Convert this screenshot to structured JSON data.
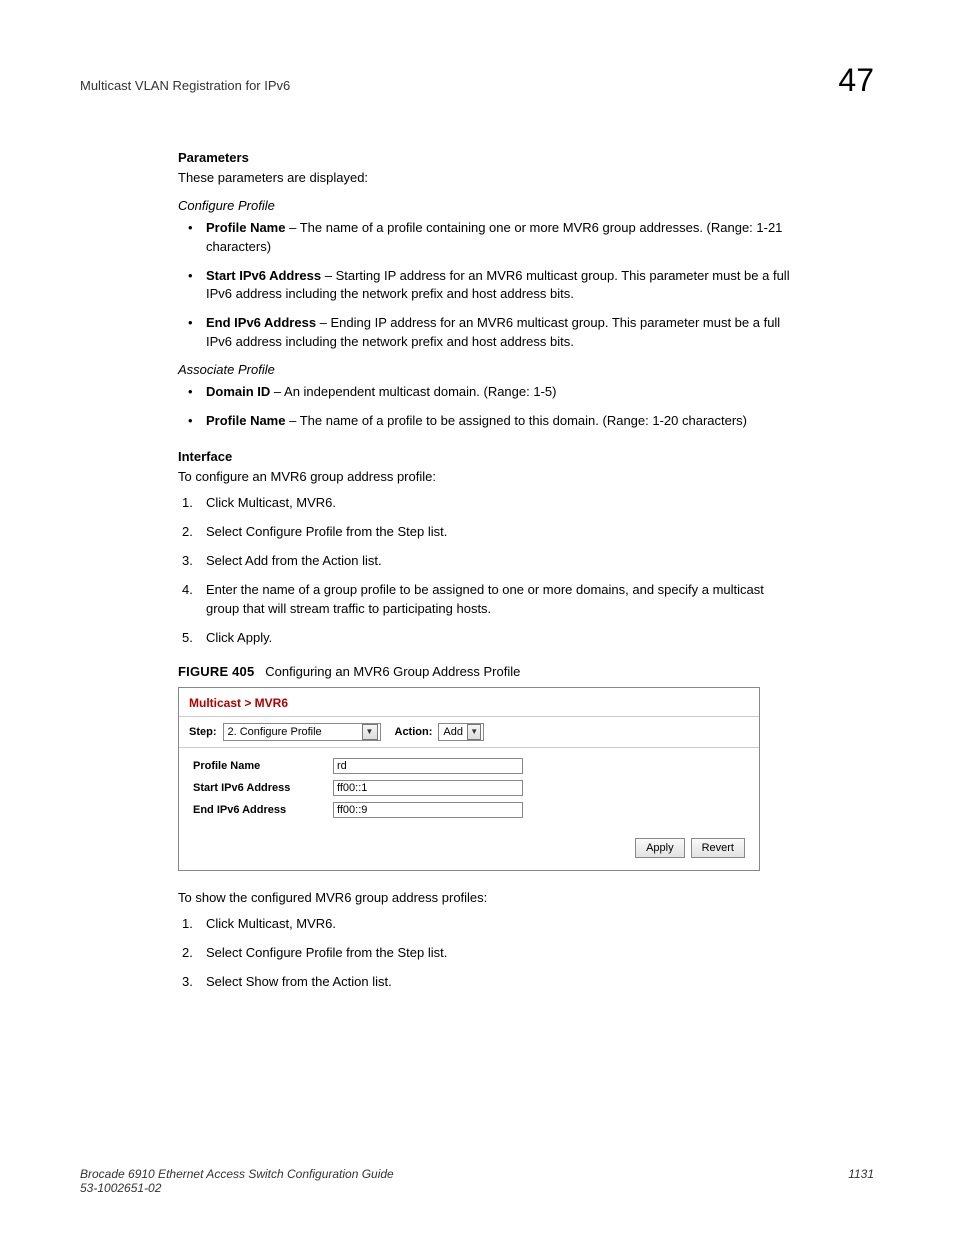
{
  "header": {
    "section_title": "Multicast VLAN Registration for IPv6",
    "chapter_number": "47"
  },
  "body": {
    "parameters_heading": "Parameters",
    "parameters_intro": "These parameters are displayed:",
    "configure_profile_label": "Configure Profile",
    "params_configure": [
      {
        "term": "Profile Name",
        "desc": " – The name of a profile containing one or more MVR6 group addresses. (Range: 1-21 characters)"
      },
      {
        "term": "Start IPv6 Address",
        "desc": " – Starting IP address for an MVR6 multicast group. This parameter must be a full IPv6 address including the network prefix and host address bits."
      },
      {
        "term": "End IPv6 Address",
        "desc": " – Ending IP address for an MVR6 multicast group. This parameter must be a full IPv6 address including the network prefix and host address bits."
      }
    ],
    "associate_profile_label": "Associate Profile",
    "params_associate": [
      {
        "term": "Domain ID",
        "desc": " – An independent multicast domain. (Range: 1-5)"
      },
      {
        "term": "Profile Name",
        "desc": " – The name of a profile to be assigned to this domain. (Range: 1-20 characters)"
      }
    ],
    "interface_heading": "Interface",
    "interface_intro": "To configure an MVR6 group address profile:",
    "steps_configure": [
      "Click Multicast, MVR6.",
      "Select Configure Profile from the Step list.",
      "Select Add from the Action list.",
      "Enter the name of a group profile to be assigned to one or more domains, and specify a multicast group that will stream traffic to participating hosts.",
      "Click Apply."
    ],
    "figure_label": "FIGURE 405",
    "figure_title": "Configuring an MVR6 Group Address Profile",
    "post_figure_intro": "To show the configured MVR6 group address profiles:",
    "steps_show": [
      "Click Multicast, MVR6.",
      "Select Configure Profile from the Step list.",
      "Select Show from the Action list."
    ]
  },
  "ui": {
    "breadcrumb": "Multicast > MVR6",
    "step_label": "Step:",
    "step_value": "2. Configure Profile",
    "action_label": "Action:",
    "action_value": "Add",
    "fields": {
      "profile_name_label": "Profile Name",
      "profile_name_value": "rd",
      "start_label": "Start IPv6 Address",
      "start_value": "ff00::1",
      "end_label": "End IPv6 Address",
      "end_value": "ff00::9"
    },
    "apply_btn": "Apply",
    "revert_btn": "Revert"
  },
  "footer": {
    "guide_title": "Brocade 6910 Ethernet Access Switch Configuration Guide",
    "doc_id": "53-1002651-02",
    "page_number": "1131"
  }
}
